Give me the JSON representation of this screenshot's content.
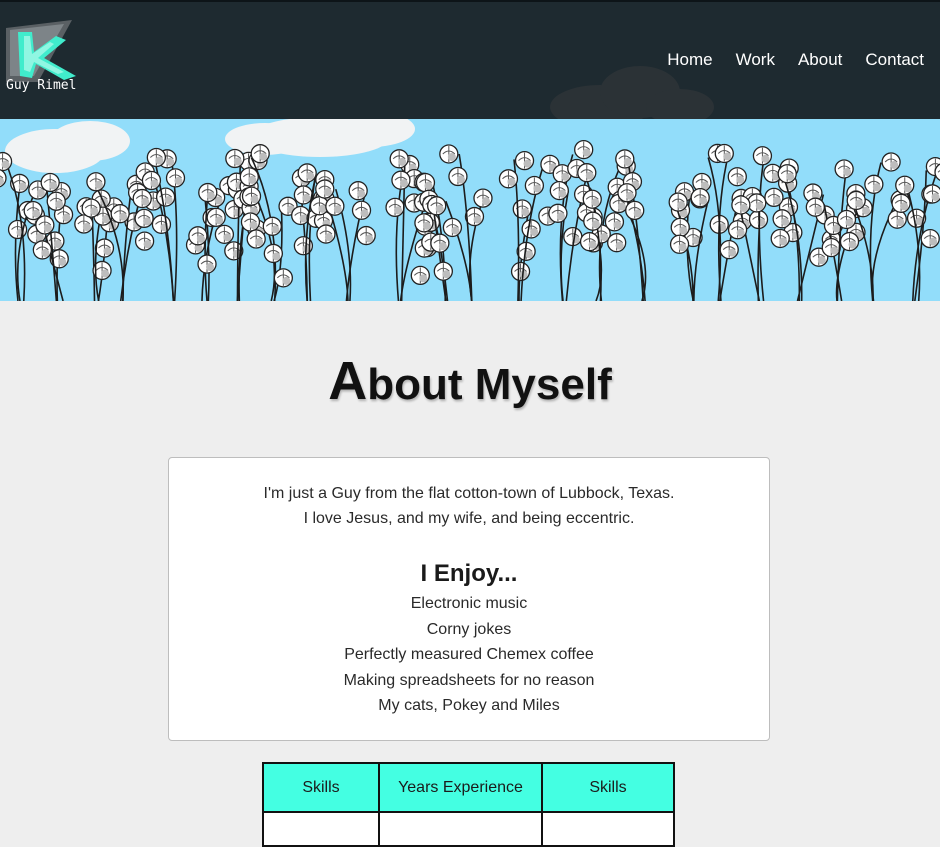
{
  "header": {
    "logo_text": "Guy Rimel",
    "nav": [
      {
        "label": "Home"
      },
      {
        "label": "Work"
      },
      {
        "label": "About"
      },
      {
        "label": "Contact"
      }
    ]
  },
  "main": {
    "title_first_letter": "A",
    "title_rest": "bout Myself",
    "intro_line_1": "I'm just a Guy from the flat cotton-town of Lubbock, Texas.",
    "intro_line_2": "I love Jesus, and my wife, and being eccentric.",
    "enjoy_heading": "I Enjoy...",
    "enjoy_items": [
      "Electronic music",
      "Corny jokes",
      "Perfectly measured Chemex coffee",
      "Making spreadsheets for no reason",
      "My cats, Pokey and Miles"
    ]
  },
  "skills_table": {
    "headers": [
      "Skills",
      "Years Experience",
      "Skills"
    ]
  },
  "colors": {
    "header_bg": "#1e2a30",
    "banner_sky": "#92ddfa",
    "page_bg": "#eeeeee",
    "table_header_bg": "#44ffe2",
    "logo_accent": "#3ee8c8"
  }
}
